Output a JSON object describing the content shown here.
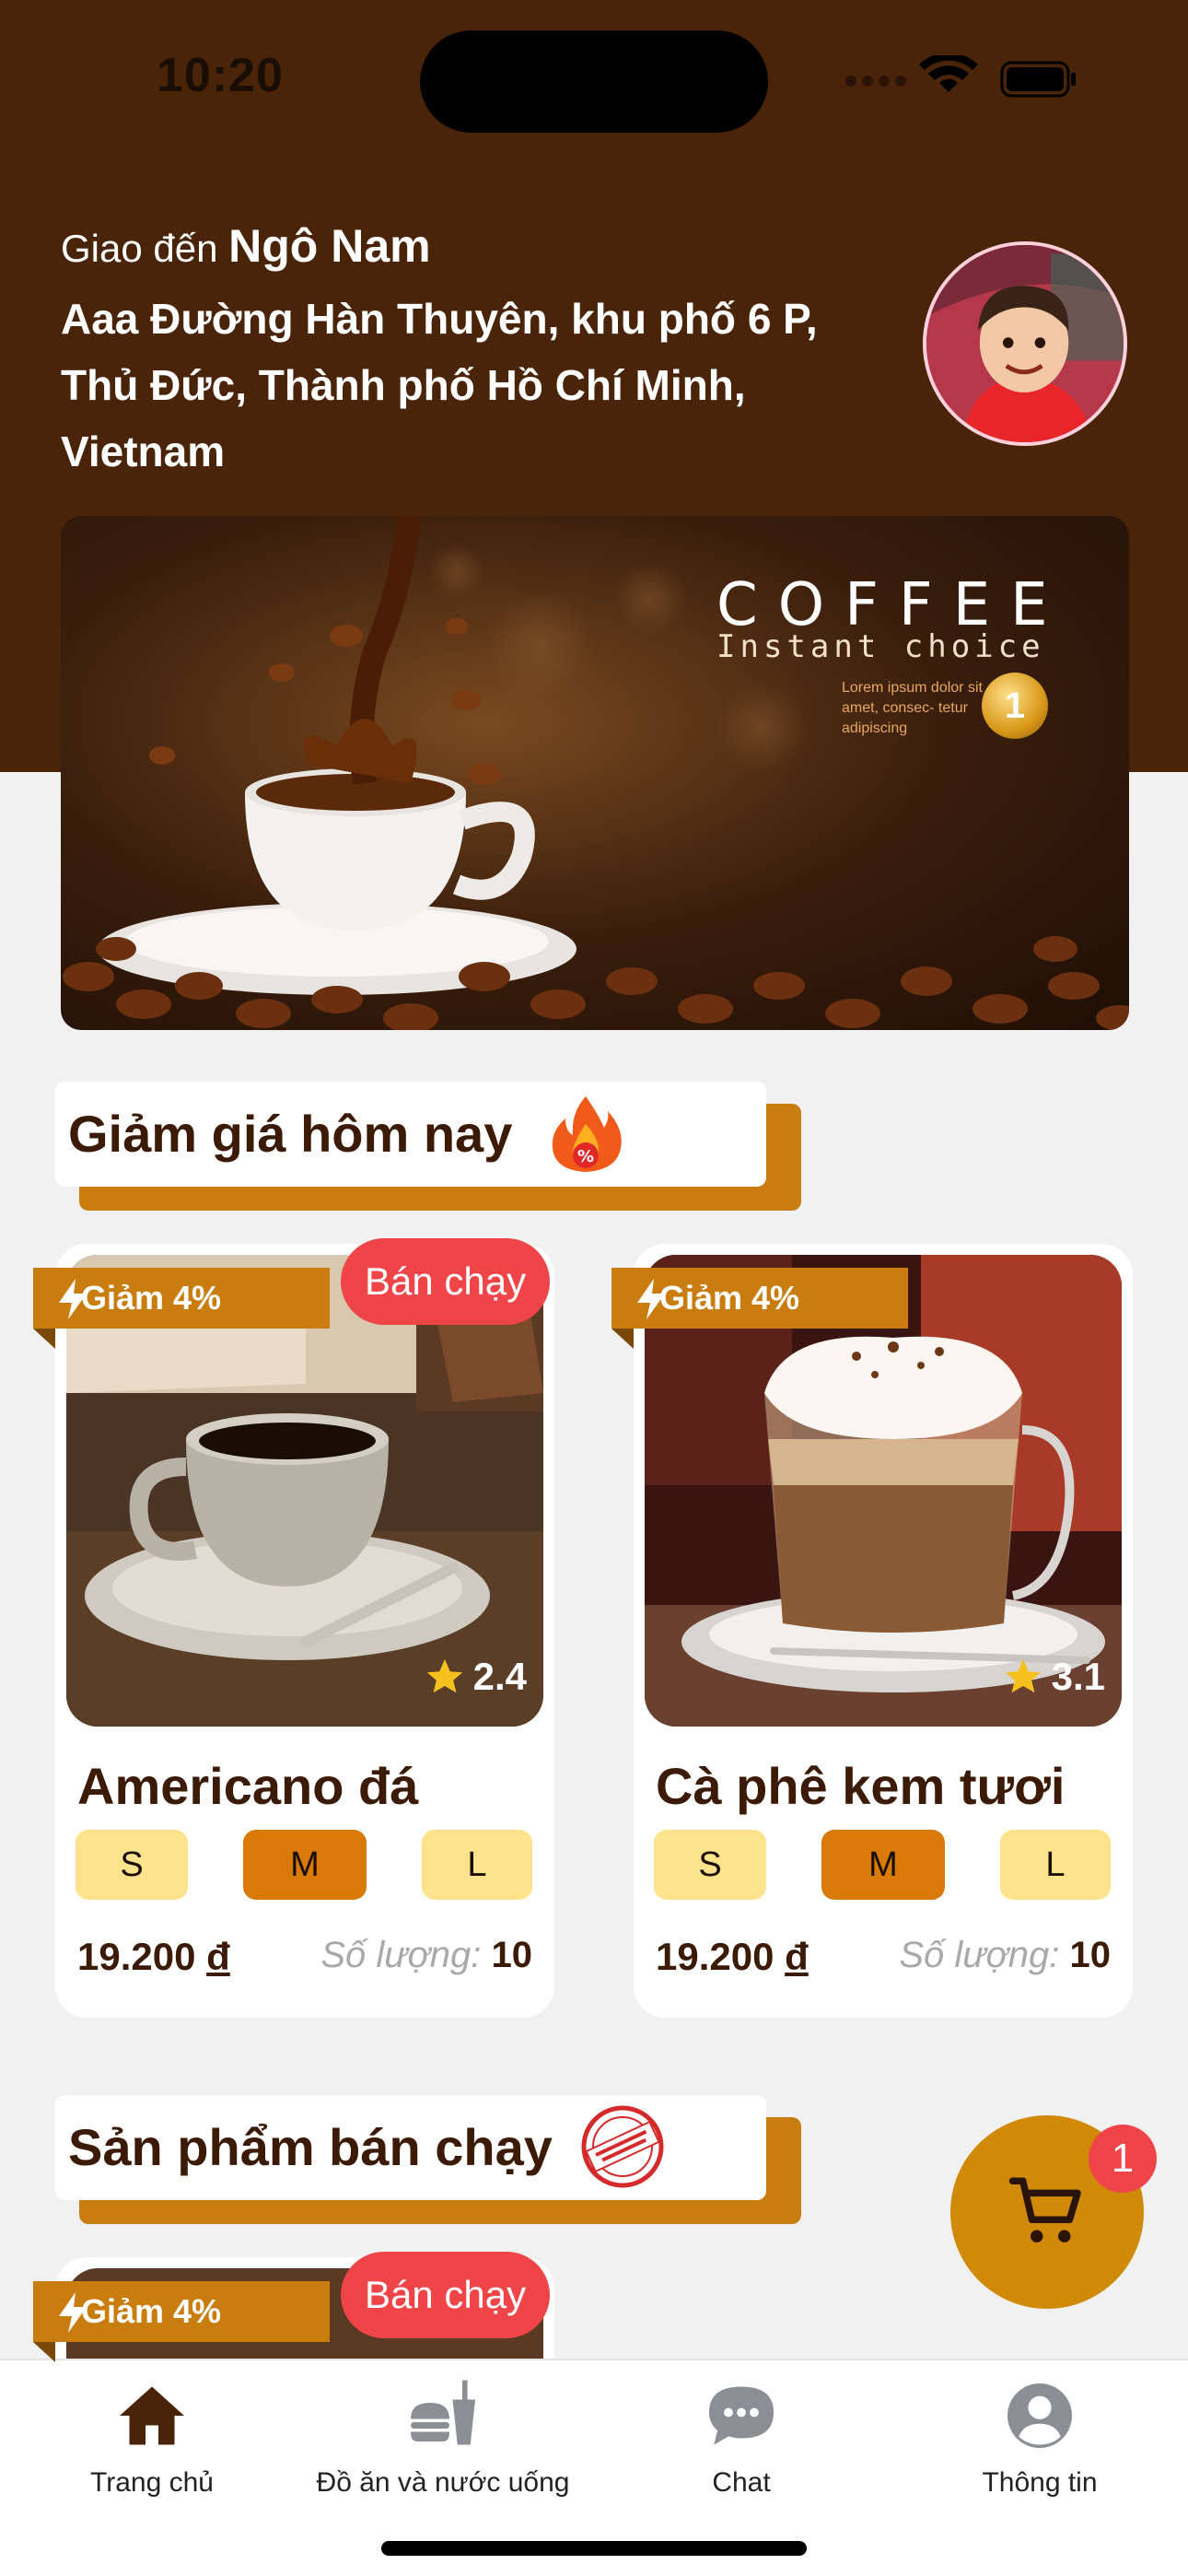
{
  "status_bar": {
    "time": "10:20"
  },
  "delivery": {
    "prefix": "Giao đến",
    "name": "Ngô Nam",
    "address": "Aaa Đường Hàn Thuyên, khu phố 6 P, Thủ Đức, Thành phố Hồ Chí Minh, Vietnam"
  },
  "banner": {
    "title": "COFFEE",
    "subtitle": "Instant choice",
    "lorem": "Lorem ipsum dolor sit amet, consec- tetur adipiscing",
    "medal": "1"
  },
  "sections": {
    "discount_title": "Giảm giá hôm nay",
    "bestseller_title": "Sản phẩm bán chạy"
  },
  "products": [
    {
      "name": "Americano đá",
      "discount": "Giảm 4%",
      "badge": "Bán chạy",
      "rating": "2.4",
      "sizes": [
        "S",
        "M",
        "L"
      ],
      "price": "19.200",
      "currency": "đ",
      "qty_label": "Số lượng:",
      "qty": "10"
    },
    {
      "name": "Cà phê kem tươi",
      "discount": "Giảm 4%",
      "badge": "",
      "rating": "3.1",
      "sizes": [
        "S",
        "M",
        "L"
      ],
      "price": "19.200",
      "currency": "đ",
      "qty_label": "Số lượng:",
      "qty": "10"
    },
    {
      "name": "",
      "discount": "Giảm 4%",
      "badge": "Bán chạy"
    }
  ],
  "cart": {
    "count": "1"
  },
  "nav": [
    {
      "label": "Trang chủ",
      "icon": "home-icon"
    },
    {
      "label": "Đồ ăn và nước uống",
      "icon": "food-drink-icon"
    },
    {
      "label": "Chat",
      "icon": "chat-icon"
    },
    {
      "label": "Thông tin",
      "icon": "profile-icon"
    }
  ],
  "colors": {
    "header": "#4a2408",
    "accent": "#c97d0e",
    "badge": "#ef4448",
    "size_selected": "#d97a06",
    "size_default": "#fde48c"
  }
}
